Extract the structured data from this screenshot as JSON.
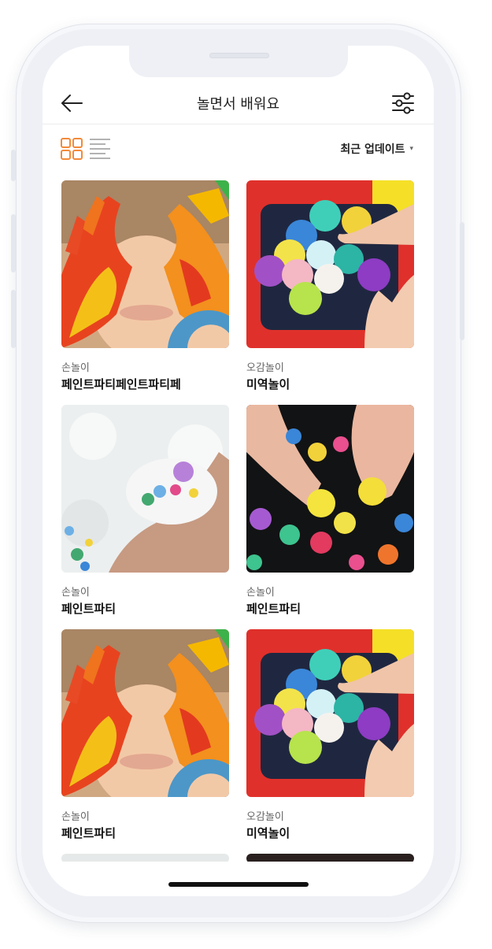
{
  "header": {
    "title": "놀면서 배워요",
    "back_icon": "arrow-left-icon",
    "filter_icon": "sliders-icon"
  },
  "toolbar": {
    "grid_icon": "grid-view-icon",
    "list_icon": "list-view-icon",
    "sort_label": "최근 업데이트",
    "sort_caret": "▾",
    "accent_color": "#f28a3a"
  },
  "items": [
    {
      "category": "손놀이",
      "name": "페인트파티페인트파티페",
      "image": "painted-hands-face"
    },
    {
      "category": "오감놀이",
      "name": "미역놀이",
      "image": "pompom-tray"
    },
    {
      "category": "손놀이",
      "name": "페인트파티",
      "image": "snow-beads-hand"
    },
    {
      "category": "손놀이",
      "name": "페인트파티",
      "image": "glitter-pompoms"
    },
    {
      "category": "손놀이",
      "name": "페인트파티",
      "image": "painted-hands-face"
    },
    {
      "category": "오감놀이",
      "name": "미역놀이",
      "image": "pompom-tray"
    }
  ]
}
